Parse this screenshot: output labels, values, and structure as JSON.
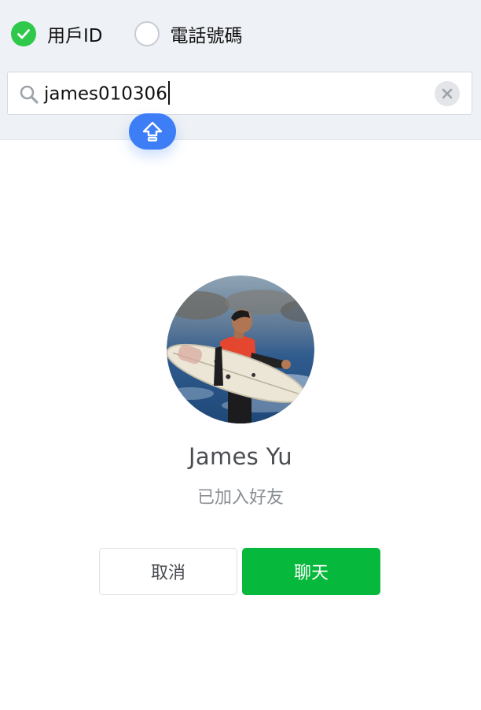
{
  "search_type": {
    "options": [
      {
        "label": "用戶ID",
        "checked": true
      },
      {
        "label": "電話號碼",
        "checked": false
      }
    ]
  },
  "search": {
    "value": "james010306",
    "icon": "search-icon",
    "clear_icon": "close-icon"
  },
  "keyboard_hint": {
    "icon": "shift-arrow-icon"
  },
  "profile": {
    "name": "James Yu",
    "status": "已加入好友"
  },
  "actions": {
    "cancel_label": "取消",
    "chat_label": "聊天"
  },
  "colors": {
    "accent_green": "#06b83b",
    "check_green": "#2ec84a",
    "shift_blue": "#3d7ef7",
    "panel_bg": "#eef1f5"
  }
}
